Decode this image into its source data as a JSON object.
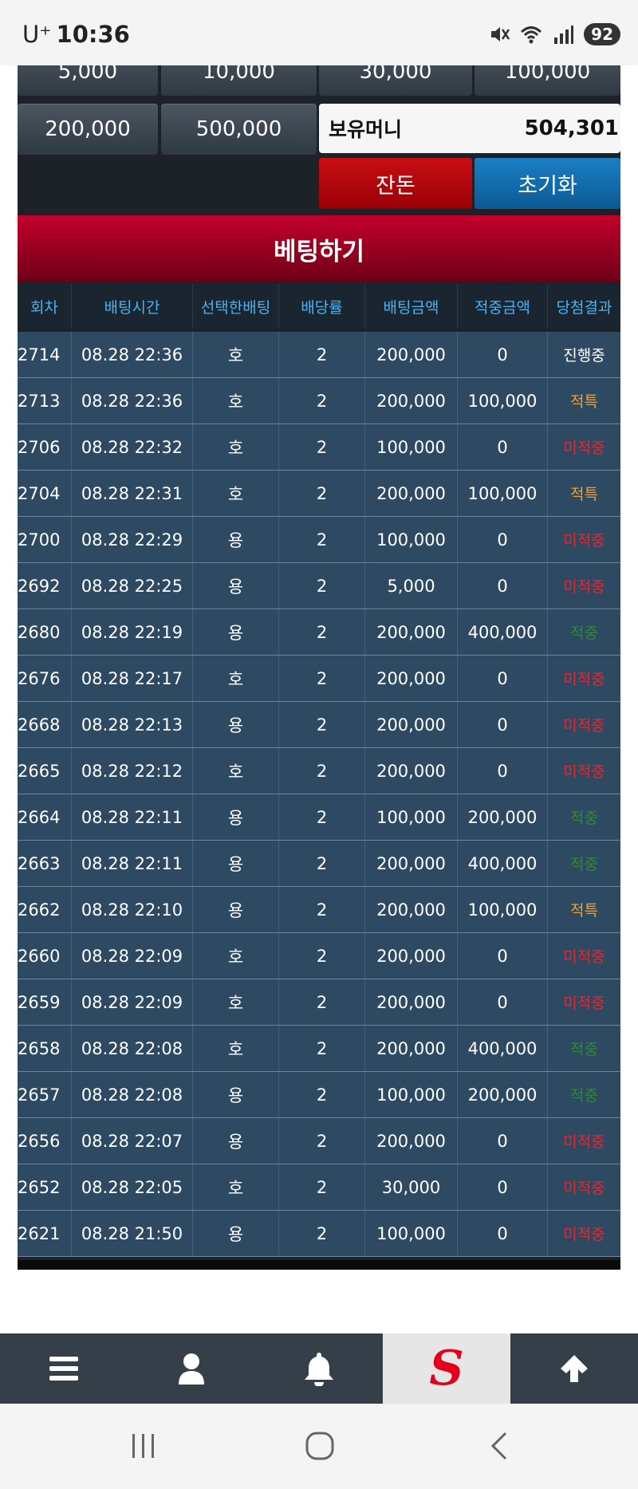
{
  "status_bar": {
    "carrier": "U⁺",
    "time": "10:36",
    "battery": "92"
  },
  "chips": {
    "row1": [
      "5,000",
      "10,000",
      "30,000",
      "100,000"
    ],
    "row2": [
      "200,000",
      "500,000"
    ]
  },
  "money": {
    "label": "보유머니",
    "value": "504,301"
  },
  "buttons": {
    "remainder": "잔돈",
    "reset": "초기화"
  },
  "bet_header": "베팅하기",
  "table": {
    "columns": [
      "회차",
      "배팅시간",
      "선택한배팅",
      "배당률",
      "배팅금액",
      "적중금액",
      "당첨결과"
    ],
    "rows": [
      {
        "round": "2714",
        "time": "08.28 22:36",
        "pick": "호",
        "odds": "2",
        "amount": "200,000",
        "win": "0",
        "result": "진행중",
        "color": "#ffffff"
      },
      {
        "round": "2713",
        "time": "08.28 22:36",
        "pick": "호",
        "odds": "2",
        "amount": "200,000",
        "win": "100,000",
        "result": "적특",
        "color": "#f0a030"
      },
      {
        "round": "2706",
        "time": "08.28 22:32",
        "pick": "호",
        "odds": "2",
        "amount": "100,000",
        "win": "0",
        "result": "미적중",
        "color": "#e8252e"
      },
      {
        "round": "2704",
        "time": "08.28 22:31",
        "pick": "호",
        "odds": "2",
        "amount": "200,000",
        "win": "100,000",
        "result": "적특",
        "color": "#f0a030"
      },
      {
        "round": "2700",
        "time": "08.28 22:29",
        "pick": "용",
        "odds": "2",
        "amount": "100,000",
        "win": "0",
        "result": "미적중",
        "color": "#e8252e"
      },
      {
        "round": "2692",
        "time": "08.28 22:25",
        "pick": "용",
        "odds": "2",
        "amount": "5,000",
        "win": "0",
        "result": "미적중",
        "color": "#e8252e"
      },
      {
        "round": "2680",
        "time": "08.28 22:19",
        "pick": "용",
        "odds": "2",
        "amount": "200,000",
        "win": "400,000",
        "result": "적중",
        "color": "#2e8b2e"
      },
      {
        "round": "2676",
        "time": "08.28 22:17",
        "pick": "호",
        "odds": "2",
        "amount": "200,000",
        "win": "0",
        "result": "미적중",
        "color": "#e8252e"
      },
      {
        "round": "2668",
        "time": "08.28 22:13",
        "pick": "용",
        "odds": "2",
        "amount": "200,000",
        "win": "0",
        "result": "미적중",
        "color": "#e8252e"
      },
      {
        "round": "2665",
        "time": "08.28 22:12",
        "pick": "호",
        "odds": "2",
        "amount": "200,000",
        "win": "0",
        "result": "미적중",
        "color": "#e8252e"
      },
      {
        "round": "2664",
        "time": "08.28 22:11",
        "pick": "용",
        "odds": "2",
        "amount": "100,000",
        "win": "200,000",
        "result": "적중",
        "color": "#2e8b2e"
      },
      {
        "round": "2663",
        "time": "08.28 22:11",
        "pick": "용",
        "odds": "2",
        "amount": "200,000",
        "win": "400,000",
        "result": "적중",
        "color": "#2e8b2e"
      },
      {
        "round": "2662",
        "time": "08.28 22:10",
        "pick": "용",
        "odds": "2",
        "amount": "200,000",
        "win": "100,000",
        "result": "적특",
        "color": "#f0a030"
      },
      {
        "round": "2660",
        "time": "08.28 22:09",
        "pick": "호",
        "odds": "2",
        "amount": "200,000",
        "win": "0",
        "result": "미적중",
        "color": "#e8252e"
      },
      {
        "round": "2659",
        "time": "08.28 22:09",
        "pick": "호",
        "odds": "2",
        "amount": "200,000",
        "win": "0",
        "result": "미적중",
        "color": "#e8252e"
      },
      {
        "round": "2658",
        "time": "08.28 22:08",
        "pick": "호",
        "odds": "2",
        "amount": "200,000",
        "win": "400,000",
        "result": "적중",
        "color": "#2e8b2e"
      },
      {
        "round": "2657",
        "time": "08.28 22:08",
        "pick": "용",
        "odds": "2",
        "amount": "100,000",
        "win": "200,000",
        "result": "적중",
        "color": "#2e8b2e"
      },
      {
        "round": "2656",
        "time": "08.28 22:07",
        "pick": "용",
        "odds": "2",
        "amount": "200,000",
        "win": "0",
        "result": "미적중",
        "color": "#e8252e"
      },
      {
        "round": "2652",
        "time": "08.28 22:05",
        "pick": "호",
        "odds": "2",
        "amount": "30,000",
        "win": "0",
        "result": "미적중",
        "color": "#e8252e"
      },
      {
        "round": "2621",
        "time": "08.28 21:50",
        "pick": "용",
        "odds": "2",
        "amount": "100,000",
        "win": "0",
        "result": "미적중",
        "color": "#e8252e"
      }
    ]
  },
  "bottom_nav": {
    "items": [
      "menu-icon",
      "user-icon",
      "bell-icon",
      "logo",
      "arrow-up-icon"
    ],
    "logo_letter": "S"
  },
  "system_nav": [
    "recents-icon",
    "home-icon",
    "back-icon"
  ]
}
